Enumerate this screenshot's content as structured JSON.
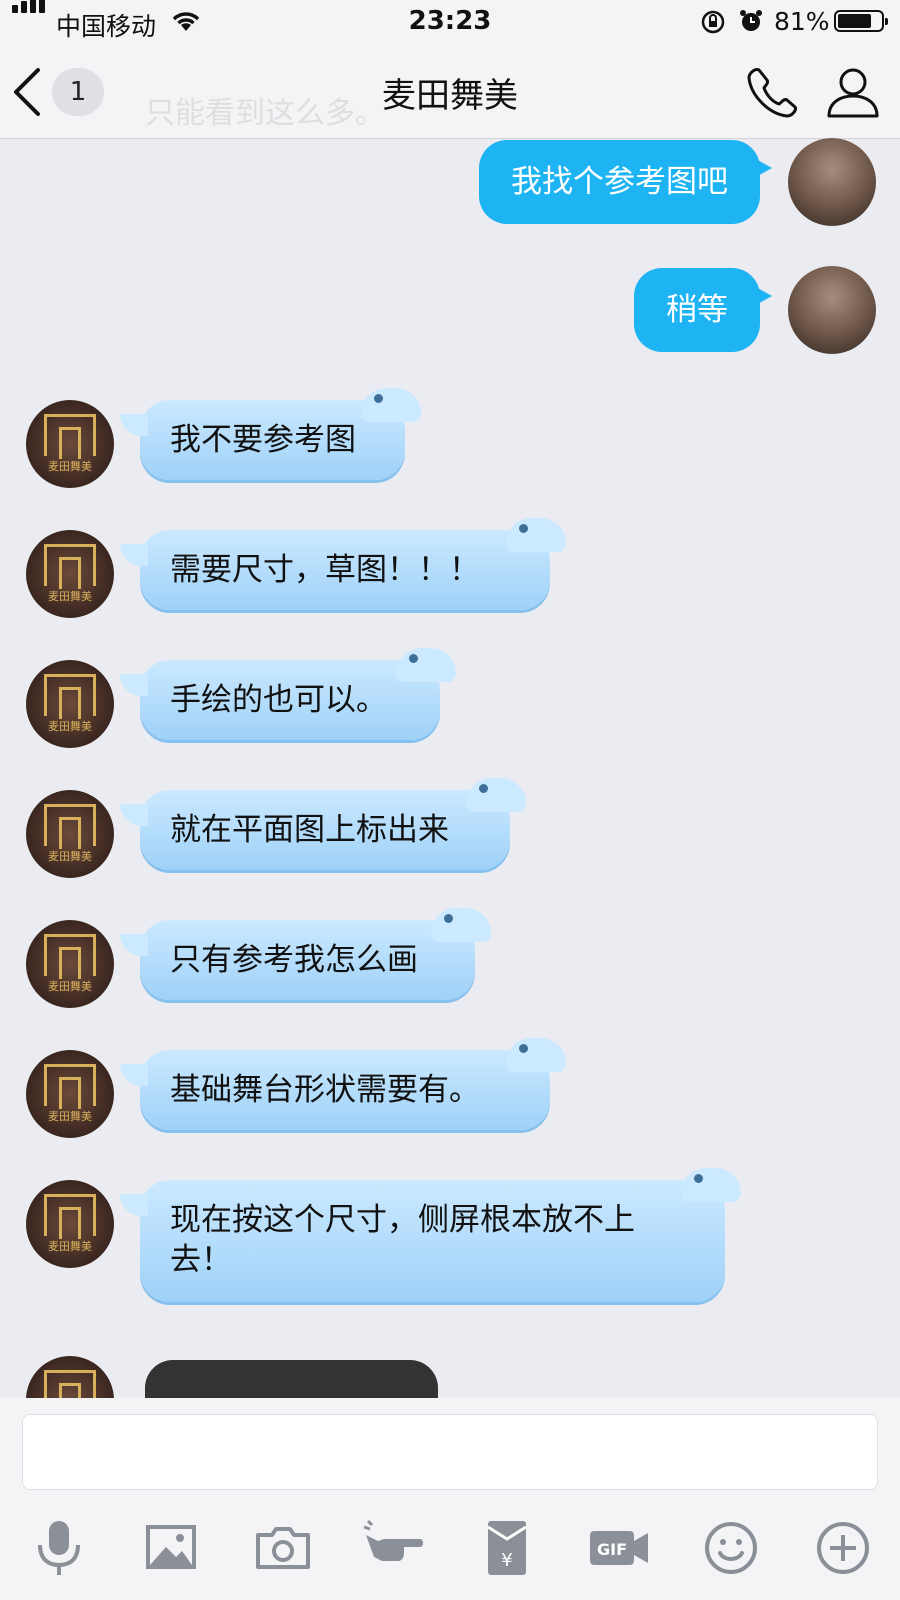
{
  "status_bar": {
    "carrier": "中国移动",
    "time": "23:23",
    "battery_percent": "81%",
    "battery_level": 0.81
  },
  "nav": {
    "unread_count": "1",
    "title": "麦田舞美"
  },
  "ghost_text": "只能看到这么多。",
  "brand_avatar_text": "麦田舞美",
  "messages": [
    {
      "side": "out",
      "text": "我找个参考图吧"
    },
    {
      "side": "out",
      "text": "稍等"
    },
    {
      "side": "in",
      "text": "我不要参考图"
    },
    {
      "side": "in",
      "text": "需要尺寸，草图！！！"
    },
    {
      "side": "in",
      "text": "手绘的也可以。"
    },
    {
      "side": "in",
      "text": "就在平面图上标出来"
    },
    {
      "side": "in",
      "text": "只有参考我怎么画"
    },
    {
      "side": "in",
      "text": "基础舞台形状需要有。"
    },
    {
      "side": "in",
      "text": "现在按这个尺寸，侧屏根本放不上去！"
    }
  ],
  "input": {
    "value": "",
    "placeholder": ""
  },
  "toolbar_icons": [
    "microphone-icon",
    "image-icon",
    "camera-icon",
    "poke-hand-icon",
    "red-packet-icon",
    "gif-icon",
    "emoji-icon",
    "plus-icon"
  ],
  "toolbar_gif_label": "GIF",
  "toolbar_yen_label": "¥",
  "colors": {
    "outgoing_bubble": "#1eb4f3",
    "incoming_bubble": "#b8defc",
    "background": "#ebecf1"
  }
}
